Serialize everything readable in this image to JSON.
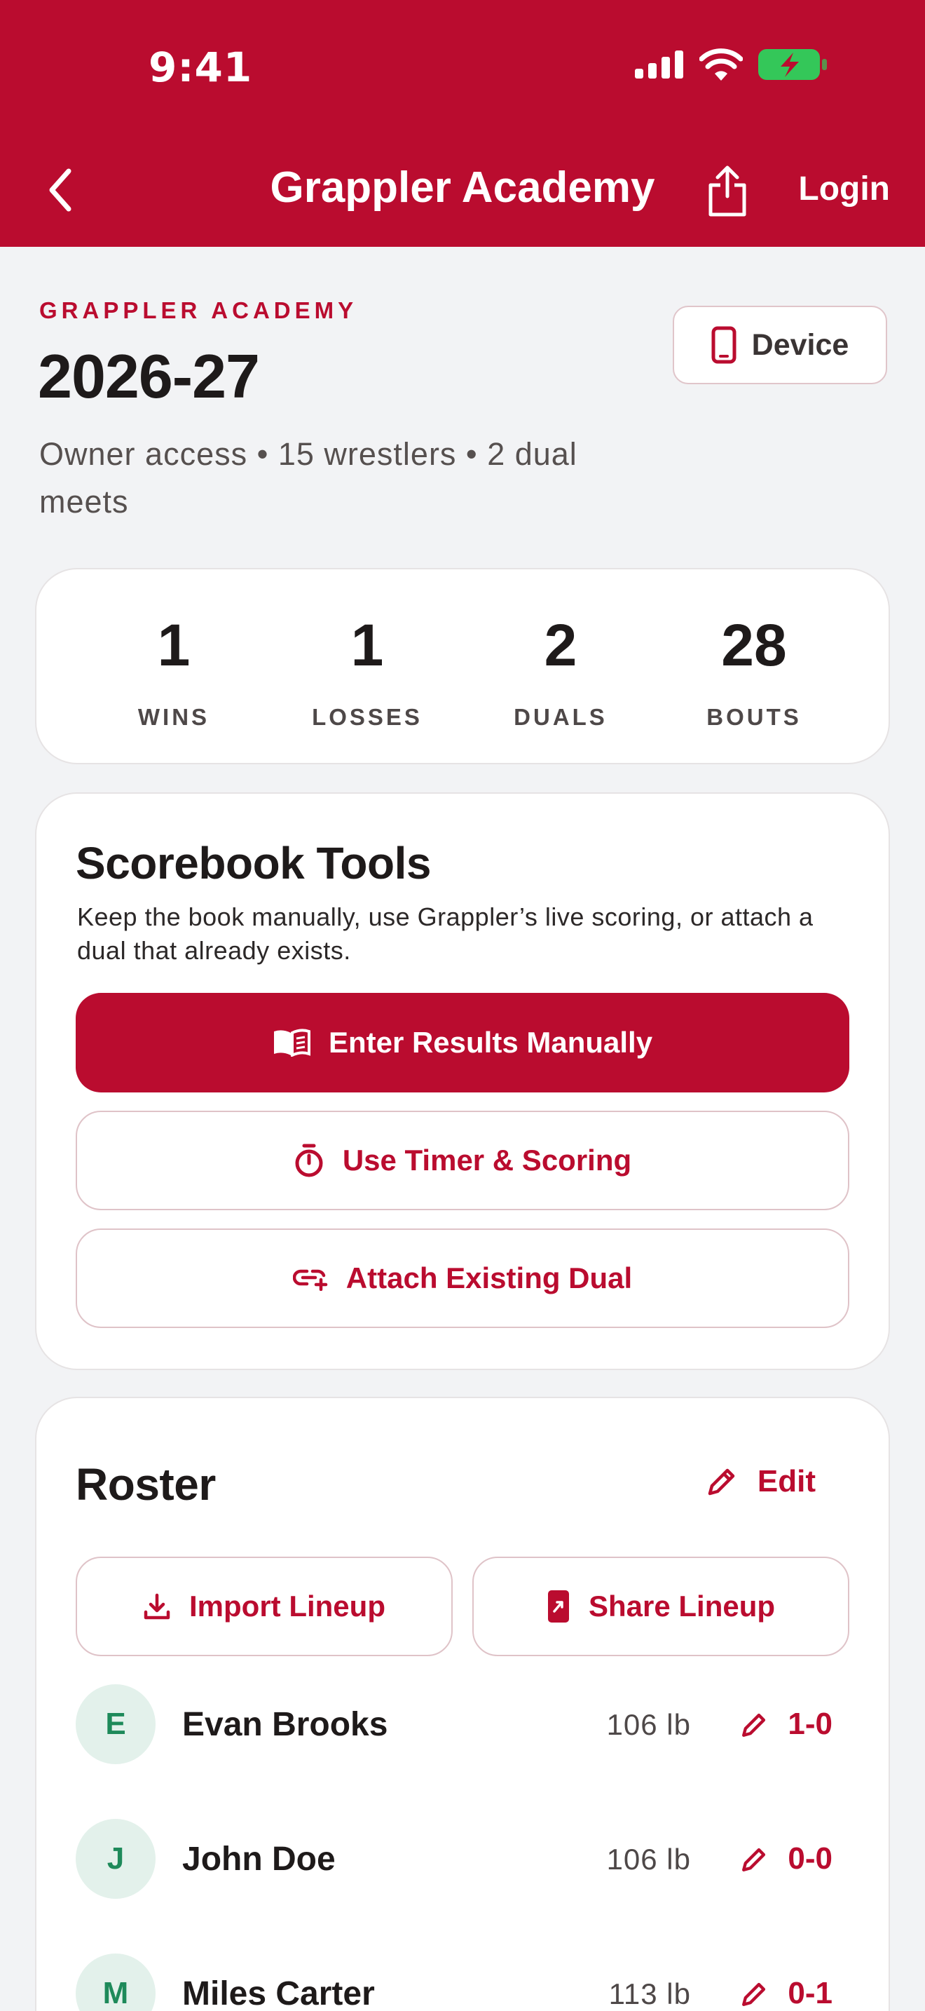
{
  "status_bar": {
    "time": "9:41",
    "icons": [
      "cellular-signal-icon",
      "wifi-icon",
      "battery-charging-icon"
    ],
    "battery_color": "#34C759"
  },
  "nav": {
    "title": "Grappler Academy",
    "login_label": "Login",
    "icons": [
      "back-chevron-icon",
      "share-icon"
    ]
  },
  "team": {
    "eyebrow": "GRAPPLER ACADEMY",
    "season": "2026-27",
    "subtitle": "Owner access • 15 wrestlers • 2 dual meets",
    "device_label": "Device"
  },
  "stats": [
    {
      "value": "1",
      "label": "WINS"
    },
    {
      "value": "1",
      "label": "LOSSES"
    },
    {
      "value": "2",
      "label": "DUALS"
    },
    {
      "value": "28",
      "label": "BOUTS"
    }
  ],
  "scorebook": {
    "title": "Scorebook Tools",
    "description": "Keep the book manually, use Grappler’s live scoring, or attach a dual that already exists.",
    "buttons": [
      {
        "label": "Enter Results Manually",
        "icon": "book-icon"
      },
      {
        "label": "Use Timer & Scoring",
        "icon": "stopwatch-icon"
      },
      {
        "label": "Attach Existing Dual",
        "icon": "link-plus-icon"
      }
    ]
  },
  "roster": {
    "title": "Roster",
    "edit_label": "Edit",
    "import_label": "Import Lineup",
    "share_label": "Share Lineup",
    "wrestlers": [
      {
        "initial": "E",
        "name": "Evan Brooks",
        "weight": "106 lb",
        "record": "1-0"
      },
      {
        "initial": "J",
        "name": "John Doe",
        "weight": "106 lb",
        "record": "0-0"
      },
      {
        "initial": "M",
        "name": "Miles Carter",
        "weight": "113 lb",
        "record": "0-1"
      }
    ]
  },
  "colors": {
    "brand": "#BA0C2F",
    "background": "#F2F3F5",
    "avatar_bg": "#E3F1EB",
    "avatar_text": "#1E8A5A"
  }
}
